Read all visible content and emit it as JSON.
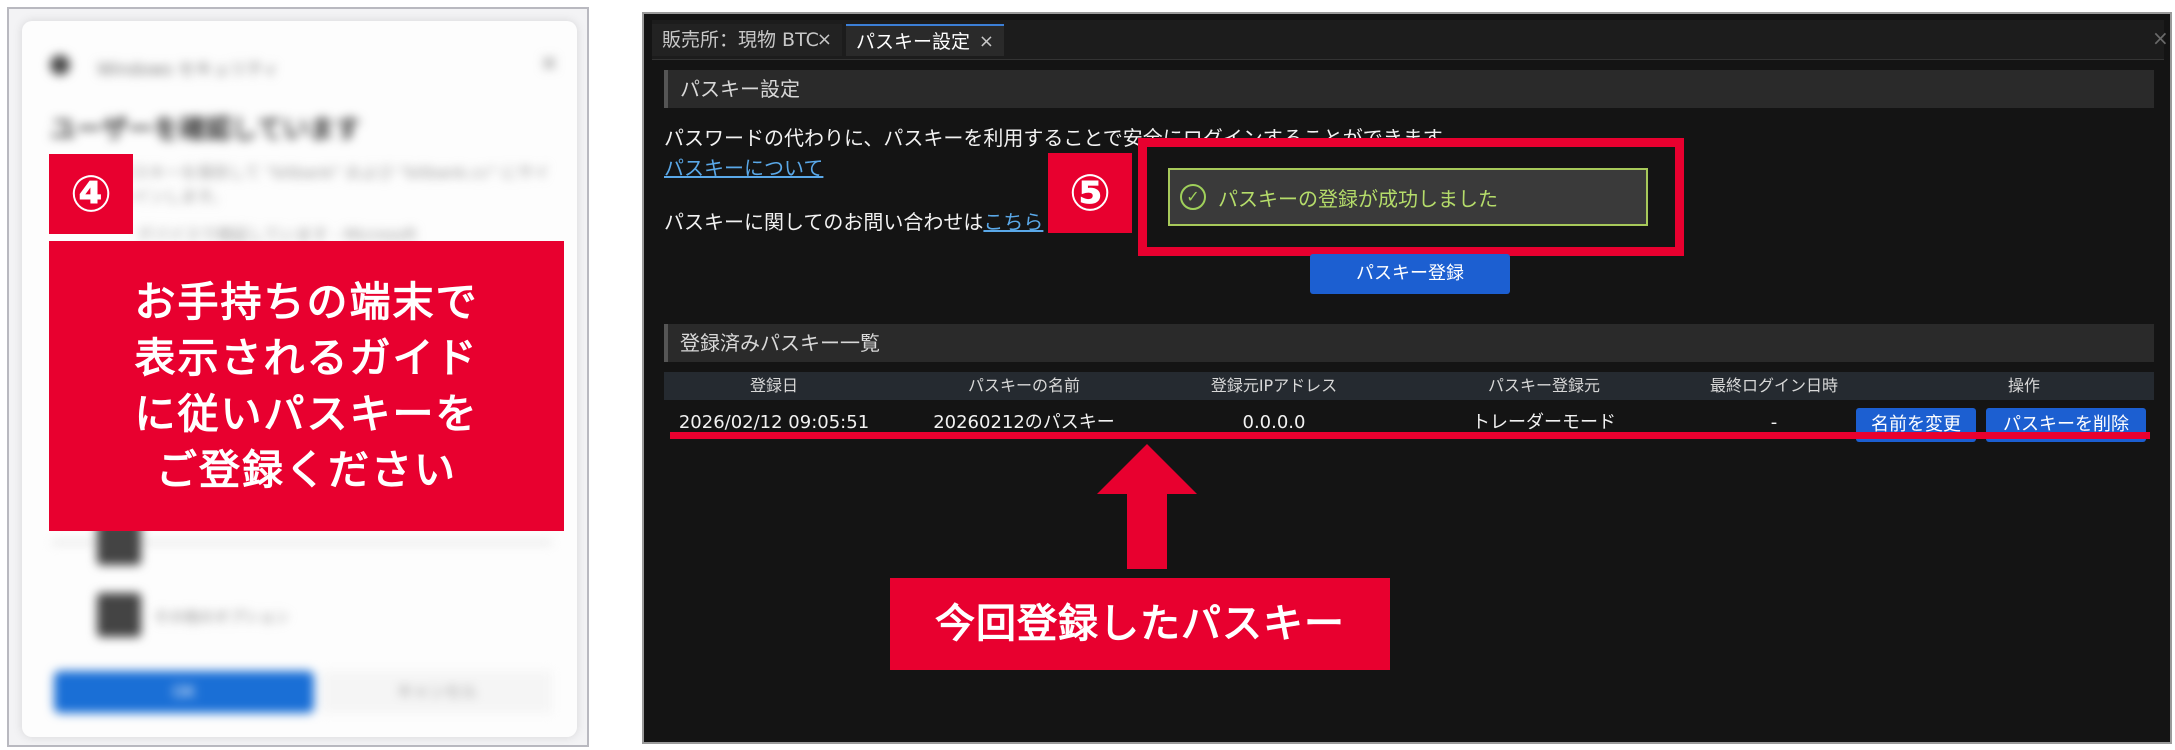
{
  "left_panel": {
    "dialog_title": "Windows セキュリティ",
    "dialog_heading": "ユーザーを確認しています",
    "dialog_body": "パスキーを保存して \"bitbank\" および \"bitbank.cc\" にサインインします。",
    "dialog_body2": "デバイスで検証しています - Microsoft",
    "dialog_option": "その他のオプション",
    "dialog_ok": "OK",
    "dialog_cancel": "キャンセル",
    "step_number": "④",
    "guide_lines": [
      "お手持ちの端末で",
      "表示されるガイド",
      "に従いパスキーを",
      "ご登録ください"
    ]
  },
  "right_panel": {
    "tabs": [
      {
        "label": "販売所：現物 BTC",
        "close": "×"
      },
      {
        "label": "パスキー設定",
        "close": "×"
      }
    ],
    "window_close": "×",
    "section1_title": "パスキー設定",
    "description": "パスワードの代わりに、パスキーを利用することで安全にログインすることができます。",
    "about_link": "パスキーについて",
    "contact_prefix": "パスキーに関してのお問い合わせは",
    "contact_link": "こちら",
    "step_number": "⑤",
    "toast_text": "パスキーの登録が成功しました",
    "toast_icon": "✓",
    "register_button": "パスキー登録",
    "section2_title": "登録済みパスキー一覧",
    "table": {
      "headers": [
        "登録日",
        "パスキーの名前",
        "登録元IPアドレス",
        "パスキー登録元",
        "最終ログイン日時",
        "操作"
      ],
      "row": {
        "date": "2026/02/12 09:05:51",
        "name": "20260212のパスキー",
        "ip": "0.0.0.0",
        "source": "トレーダーモード",
        "last_login": "-",
        "rename": "名前を変更",
        "delete": "パスキーを削除"
      }
    },
    "annotation_label": "今回登録したパスキー"
  },
  "colors": {
    "accent_red": "#e8002f",
    "button_blue": "#1c5fd1",
    "link_blue": "#5aa8e8",
    "success_green": "#b5dc6a"
  }
}
